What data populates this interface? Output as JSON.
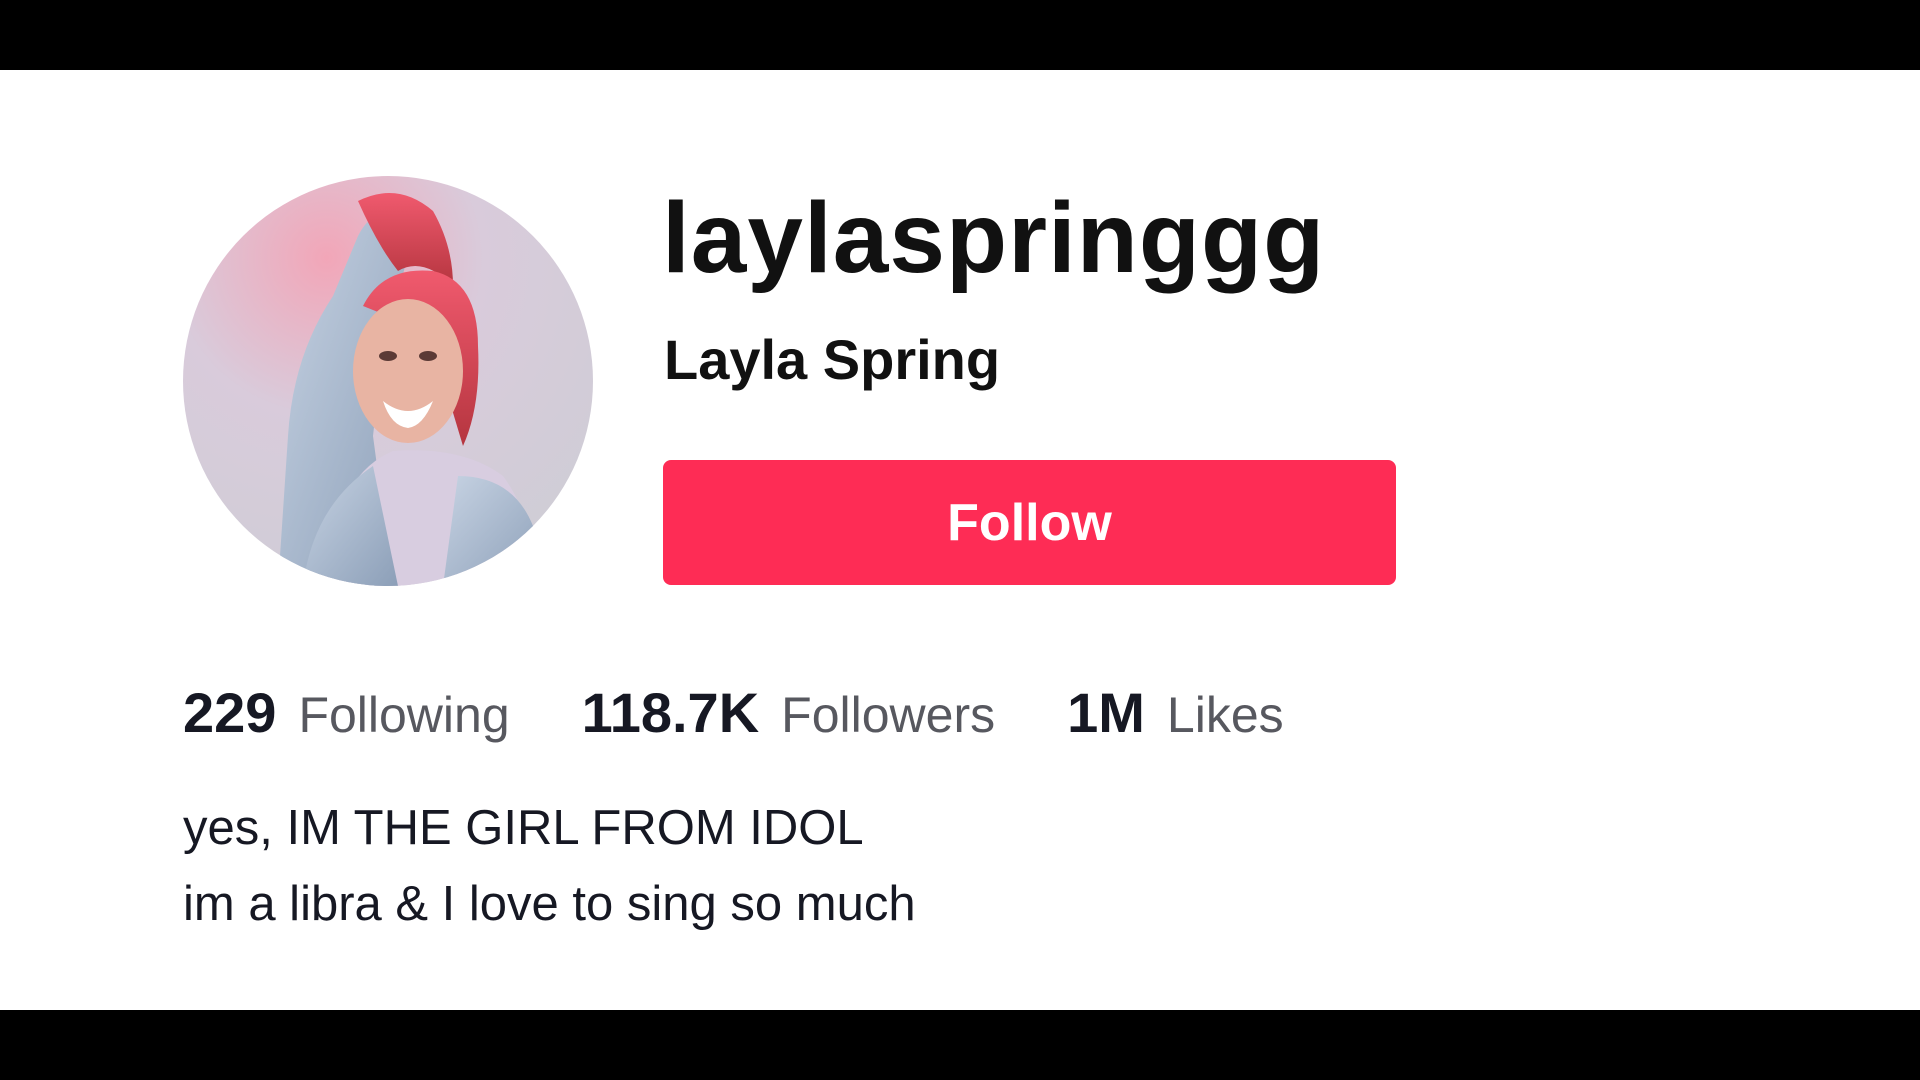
{
  "profile": {
    "username": "laylaspringgg",
    "display_name": "Layla Spring",
    "avatar_icon": "profile-photo",
    "follow_label": "Follow",
    "accent_color": "#fe2c55"
  },
  "stats": {
    "following": {
      "value": "229",
      "label": "Following"
    },
    "followers": {
      "value": "118.7K",
      "label": "Followers"
    },
    "likes": {
      "value": "1M",
      "label": "Likes"
    }
  },
  "bio": {
    "line1": "yes, IM THE GIRL FROM IDOL",
    "line2": "im a libra & I love to sing so much"
  }
}
